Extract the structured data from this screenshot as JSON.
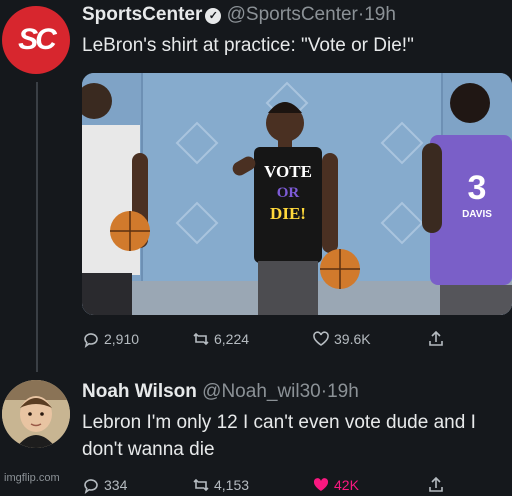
{
  "tweet": {
    "avatar_text": "SC",
    "name": "SportsCenter",
    "handle": "@SportsCenter",
    "sep": "·",
    "time": "19h",
    "text": "LeBron's shirt at practice: \"Vote or Die!\"",
    "shirt_lines": [
      "VOTE",
      "OR",
      "DIE!"
    ],
    "jersey_number": "3",
    "jersey_name": "DAVIS",
    "actions": {
      "replies": "2,910",
      "retweets": "6,224",
      "likes": "39.6K"
    }
  },
  "reply": {
    "name": "Noah Wilson",
    "handle": "@Noah_wil30",
    "sep": "·",
    "time": "19h",
    "text": "Lebron I'm only 12 I can't even vote dude and I don't wanna die",
    "actions": {
      "replies": "334",
      "retweets": "4,153",
      "likes": "42K"
    }
  },
  "watermark": "imgflip.com",
  "colors": {
    "background": "#15181c",
    "brand_red": "#d7262e",
    "like_pink": "#f91880",
    "secondary_text": "#8b9196"
  }
}
